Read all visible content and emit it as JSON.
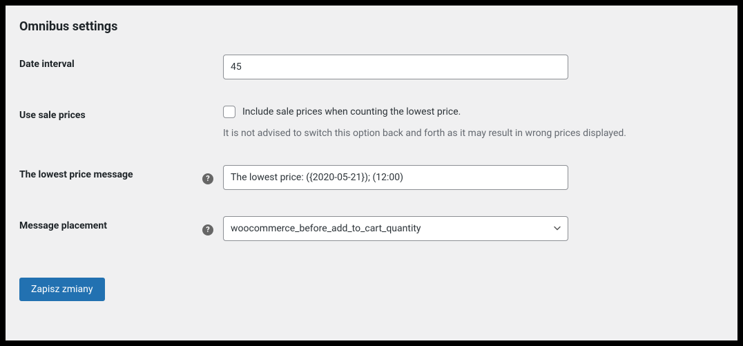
{
  "section": {
    "title": "Omnibus settings"
  },
  "fields": {
    "date_interval": {
      "label": "Date interval",
      "value": "45"
    },
    "use_sale_prices": {
      "label": "Use sale prices",
      "checkbox_label": "Include sale prices when counting the lowest price.",
      "description": "It is not advised to switch this option back and forth as it may result in wrong prices displayed."
    },
    "lowest_price_message": {
      "label": "The lowest price message",
      "value": "The lowest price: ({2020-05-21}); (12:00)"
    },
    "message_placement": {
      "label": "Message placement",
      "value": "woocommerce_before_add_to_cart_quantity"
    }
  },
  "buttons": {
    "submit": "Zapisz zmiany"
  }
}
